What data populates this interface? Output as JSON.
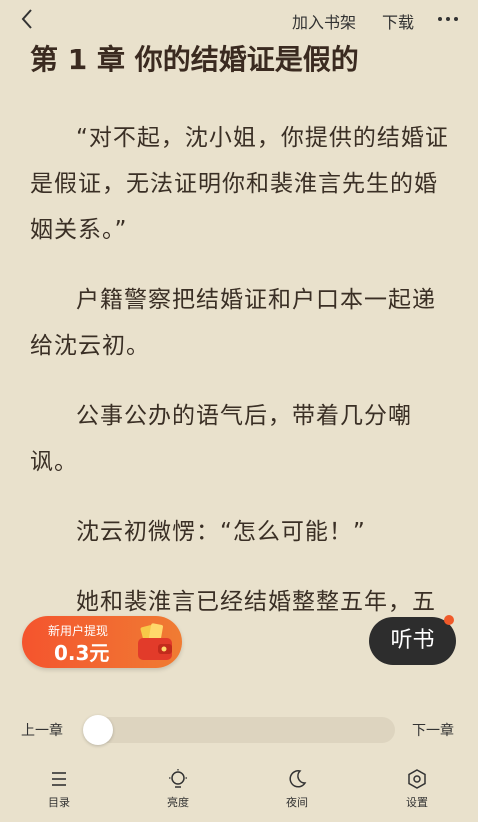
{
  "topbar": {
    "add_shelf": "加入书架",
    "download": "下载"
  },
  "chapter": {
    "title": "第 1 章 你的结婚证是假的",
    "paragraphs": [
      "“对不起，沈小姐，你提供的结婚证是假证，无法证明你和裴淮言先生的婚姻关系。”",
      "户籍警察把结婚证和户口本一起递给沈云初。",
      "公事公办的语气后，带着几分嘲讽。",
      "沈云初微愣：“怎么可能！”",
      "她和裴淮言已经结婚整整五年，五"
    ]
  },
  "promo": {
    "line1": "新用户提现",
    "amount": "0.3元"
  },
  "listen": {
    "label": "听书"
  },
  "progress": {
    "prev": "上一章",
    "next": "下一章",
    "fraction": 0.0
  },
  "bottom_tabs": {
    "catalog": "目录",
    "brightness": "亮度",
    "night": "夜间",
    "settings": "设置"
  }
}
